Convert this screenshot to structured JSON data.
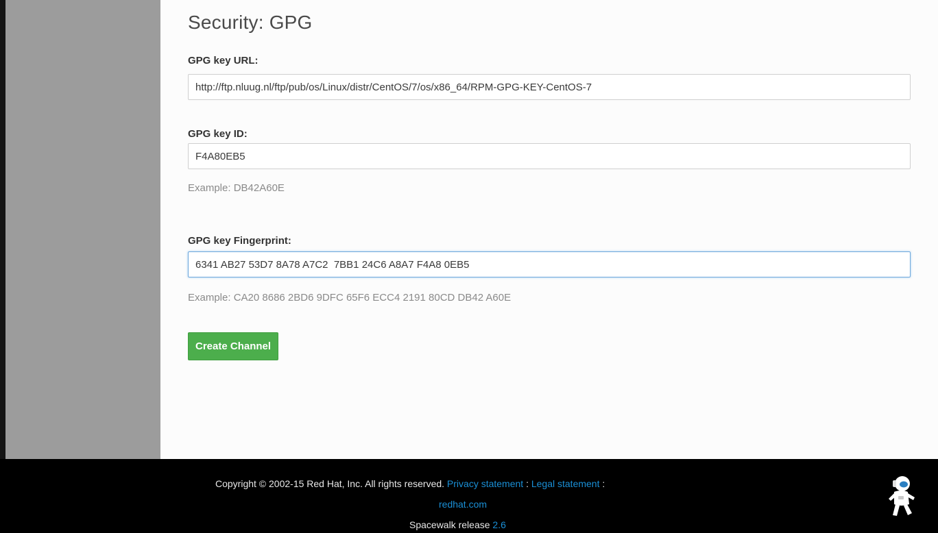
{
  "main": {
    "section_title": "Security: GPG",
    "gpg_key_url": {
      "label": "GPG key URL:",
      "value": "http://ftp.nluug.nl/ftp/pub/os/Linux/distr/CentOS/7/os/x86_64/RPM-GPG-KEY-CentOS-7"
    },
    "gpg_key_id": {
      "label": "GPG key ID:",
      "value": "F4A80EB5",
      "example": "Example: DB42A60E"
    },
    "gpg_key_fingerprint": {
      "label": "GPG key Fingerprint:",
      "value": "6341 AB27 53D7 8A78 A7C2  7BB1 24C6 A8A7 F4A8 0EB5",
      "example": "Example: CA20 8686 2BD6 9DFC 65F6 ECC4 2191 80CD DB42 A60E"
    },
    "create_button_label": "Create Channel"
  },
  "footer": {
    "copyright": "Copyright © 2002-15 Red Hat, Inc. All rights reserved.",
    "privacy_link": "Privacy statement",
    "separator": ":",
    "legal_link": "Legal statement",
    "redhat_link": "redhat.com",
    "release_prefix": "Spacewalk release",
    "release_version": "2.6",
    "mascot_icon": "spacewalk-astronaut-icon"
  },
  "colors": {
    "sidebar": "#9c9c9c",
    "button_green": "#4cae4c",
    "link_blue": "#1a8fd6",
    "footer_bg": "#000000"
  }
}
